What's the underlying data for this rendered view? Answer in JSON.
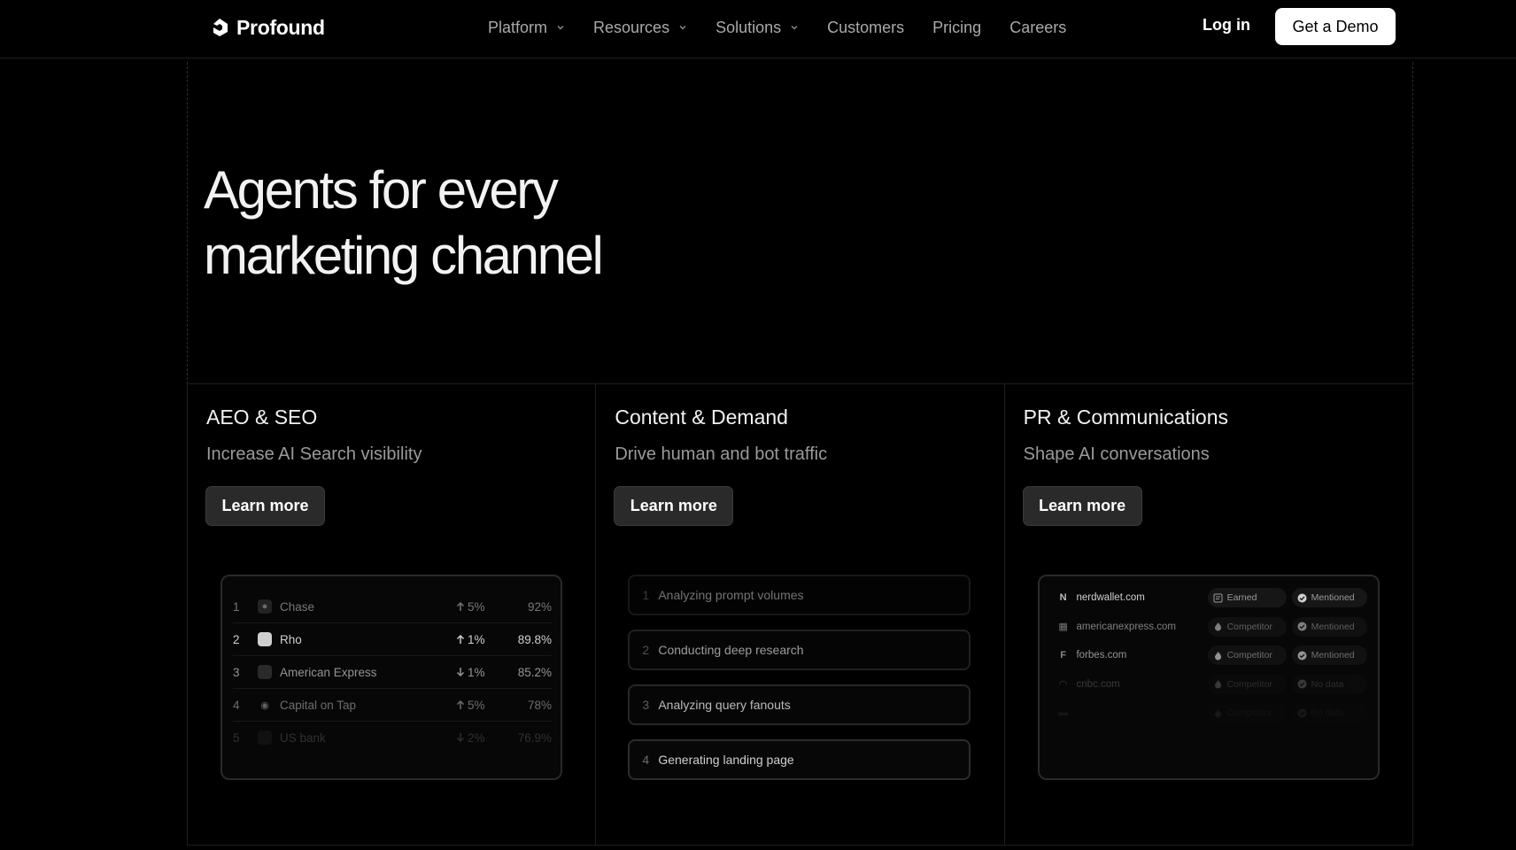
{
  "nav": {
    "brand": "Profound",
    "menu": [
      {
        "label": "Platform",
        "dropdown": true
      },
      {
        "label": "Resources",
        "dropdown": true
      },
      {
        "label": "Solutions",
        "dropdown": true
      },
      {
        "label": "Customers",
        "dropdown": false
      },
      {
        "label": "Pricing",
        "dropdown": false
      },
      {
        "label": "Careers",
        "dropdown": false
      }
    ],
    "login": "Log in",
    "cta": "Get a Demo"
  },
  "hero": {
    "line1": "Agents for every",
    "line2": "marketing channel"
  },
  "cards": [
    {
      "title": "AEO & SEO",
      "subtitle": "Increase AI Search visibility",
      "button": "Learn more",
      "rankings": [
        {
          "rank": "1",
          "name": "Chase",
          "dir": "up",
          "delta": "5%",
          "share": "92%",
          "opacity": 0.55
        },
        {
          "rank": "2",
          "name": "Rho",
          "dir": "up",
          "delta": "1%",
          "share": "89.8%",
          "opacity": 1
        },
        {
          "rank": "3",
          "name": "American Express",
          "dir": "down",
          "delta": "1%",
          "share": "85.2%",
          "opacity": 0.7
        },
        {
          "rank": "4",
          "name": "Capital on Tap",
          "dir": "up",
          "delta": "5%",
          "share": "78%",
          "opacity": 0.5
        },
        {
          "rank": "5",
          "name": "US bank",
          "dir": "down",
          "delta": "2%",
          "share": "76.9%",
          "opacity": 0.2
        }
      ]
    },
    {
      "title": "Content & Demand",
      "subtitle": "Drive human and bot traffic",
      "button": "Learn more",
      "steps": [
        {
          "num": "1",
          "label": "Analyzing prompt volumes",
          "opacity": 0.55
        },
        {
          "num": "2",
          "label": "Conducting deep research",
          "opacity": 0.75
        },
        {
          "num": "3",
          "label": "Analyzing query fanouts",
          "opacity": 0.9
        },
        {
          "num": "4",
          "label": "Generating landing page",
          "opacity": 1
        }
      ]
    },
    {
      "title": "PR & Communications",
      "subtitle": "Shape AI conversations",
      "button": "Learn more",
      "domains": [
        {
          "name": "nerdwallet.com",
          "source": "Earned",
          "status": "Mentioned",
          "opacity": 1
        },
        {
          "name": "americanexpress.com",
          "source": "Competitor",
          "status": "Mentioned",
          "opacity": 0.6
        },
        {
          "name": "forbes.com",
          "source": "Competitor",
          "status": "Mentioned",
          "opacity": 0.7
        },
        {
          "name": "cnbc.com",
          "source": "Competitor",
          "status": "No data",
          "opacity": 0.25
        },
        {
          "name": "",
          "source": "Competitor",
          "status": "No data",
          "opacity": 0.08
        }
      ]
    }
  ],
  "colors": {
    "background": "#000000",
    "text": "#f2f2f2",
    "muted": "#9a9a9a",
    "button_dark": "#2a2a2a",
    "cta": "#ffffff"
  }
}
